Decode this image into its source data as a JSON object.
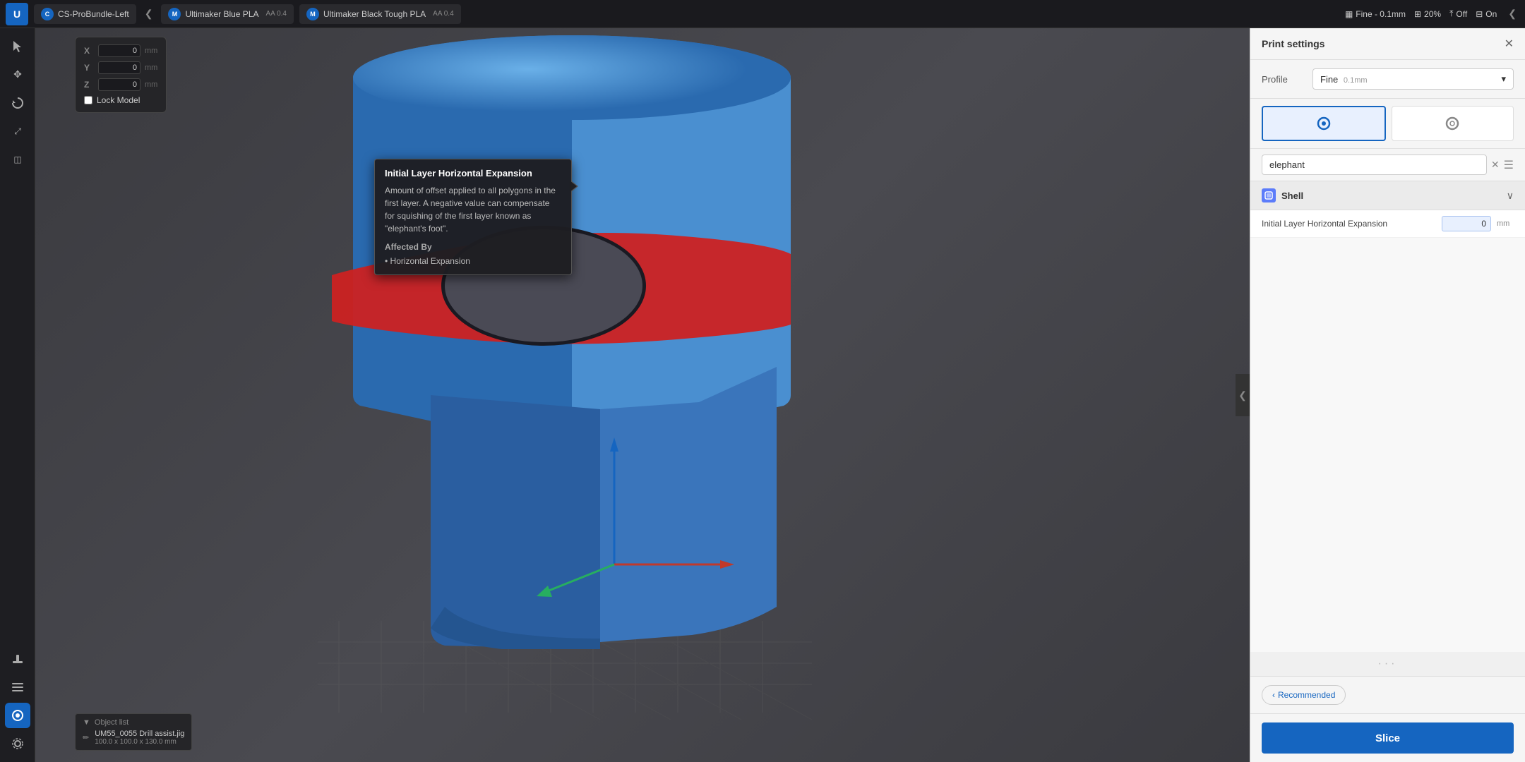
{
  "topbar": {
    "logo": "U",
    "items": [
      {
        "id": "cs-pro-bundle-left",
        "icon_label": "C",
        "label": "CS-ProBundle-Left",
        "has_arrow_left": true
      },
      {
        "id": "ultimaker-blue-pla",
        "icon_label": "M",
        "label": "Ultimaker Blue PLA",
        "sublabel": "AA 0.4"
      },
      {
        "id": "ultimaker-black-tough-pla",
        "icon_label": "M",
        "label": "Ultimaker Black Tough PLA",
        "sublabel": "AA 0.4"
      }
    ],
    "right_items": [
      {
        "id": "profile-quality",
        "label": "Fine - 0.1mm"
      },
      {
        "id": "infill",
        "icon": "grid",
        "label": "20%"
      },
      {
        "id": "support",
        "icon": "support",
        "label": "Off"
      },
      {
        "id": "adhesion",
        "icon": "adhesion",
        "label": "On"
      }
    ],
    "collapse_arrow": "‹"
  },
  "left_toolbar": {
    "buttons": [
      {
        "id": "select",
        "icon": "⊹",
        "active": false
      },
      {
        "id": "move",
        "icon": "✥",
        "active": false
      },
      {
        "id": "rotate",
        "icon": "↻",
        "active": false
      },
      {
        "id": "scale",
        "icon": "⤢",
        "active": false
      },
      {
        "id": "mirror",
        "icon": "◫",
        "active": false
      },
      {
        "id": "support",
        "icon": "🔧",
        "active": false
      },
      {
        "id": "layer-view",
        "icon": "≡",
        "active": false
      },
      {
        "id": "monitor",
        "icon": "◉",
        "selected": true
      },
      {
        "id": "settings",
        "icon": "⚙",
        "active": false
      }
    ]
  },
  "coords": {
    "x_label": "X",
    "x_value": "0",
    "y_label": "Y",
    "y_value": "0",
    "z_label": "Z",
    "z_value": "0",
    "unit": "mm",
    "lock_label": "Lock Model"
  },
  "tooltip": {
    "title": "Initial Layer Horizontal Expansion",
    "description": "Amount of offset applied to all polygons in the first layer. A negative value can compensate for squishing of the first layer known as \"elephant's foot\".",
    "affected_by_label": "Affected By",
    "affected_items": [
      "Horizontal Expansion"
    ]
  },
  "object_list": {
    "header": "Object list",
    "item_name": "UM55_0055 Drill assist.jig",
    "item_size": "100.0 x 100.0 x 130.0 mm"
  },
  "right_panel": {
    "title": "Print settings",
    "close_icon": "✕",
    "profile_label": "Profile",
    "profile_value": "Fine",
    "profile_sub": "0.1mm",
    "mode_icons": [
      {
        "id": "mode-1",
        "icon": "◉",
        "active": true
      },
      {
        "id": "mode-2",
        "icon": "◎",
        "active": false
      }
    ],
    "search": {
      "placeholder": "elephant",
      "value": "elephant",
      "clear_icon": "✕",
      "menu_icon": "☰"
    },
    "shell_section": {
      "title": "Shell",
      "icon": "◈",
      "chevron": "∨",
      "settings": [
        {
          "id": "initial-layer-horizontal-expansion",
          "label": "Initial Layer Horizontal Expansion",
          "value": "0",
          "unit": "mm"
        }
      ]
    },
    "recommended_btn": "Recommended",
    "chevron_left": "‹",
    "slice_btn": "Slice",
    "dots": "···"
  }
}
